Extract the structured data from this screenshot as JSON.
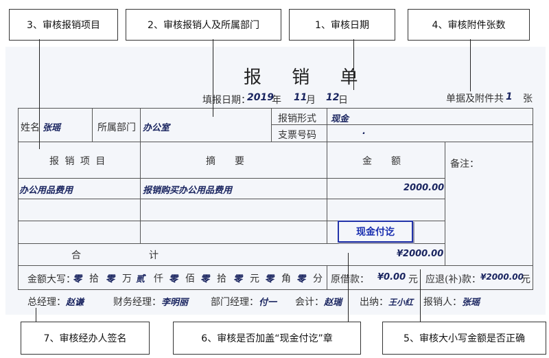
{
  "callouts": {
    "c1": "1、审核日期",
    "c2": "2、审核报销人及所属部门",
    "c3": "3、审核报销项目",
    "c4": "4、审核附件张数",
    "c5": "5、审核大小写金额是否正确",
    "c6": "6、审核是否加盖“现金付讫”章",
    "c7": "7、审核经办人签名"
  },
  "form": {
    "title": "报 销 单",
    "date_label": "填报日期：",
    "year": "2019",
    "year_unit": "年",
    "month": "11",
    "month_unit": "月",
    "day": "12",
    "day_unit": "日",
    "attach_label": "单据及附件共",
    "attach_count": "1",
    "attach_unit": "张",
    "name_label": "姓名",
    "name_value": "张瑶",
    "dept_label": "所属部门",
    "dept_value": "办公室",
    "reimb_type_label": "报销形式",
    "reimb_type_value": "现金",
    "check_no_label": "支票号码",
    "check_no_value": ".",
    "col_item": "报 销 项 目",
    "col_summary": "摘　　要",
    "col_amount": "金　　额",
    "remarks_label": "备注：",
    "rows": [
      {
        "item": "办公用品费用",
        "summary": "报销购买办公用品费用",
        "amount": "2000.00"
      },
      {
        "item": "",
        "summary": "",
        "amount": ""
      },
      {
        "item": "",
        "summary": "",
        "amount": ""
      }
    ],
    "stamp": "现金付讫",
    "total_label_1": "合",
    "total_label_2": "计",
    "total_value": "¥2000.00",
    "capital_label": "金额大写：",
    "capital_parts": [
      {
        "v": "零",
        "u": "拾"
      },
      {
        "v": "零",
        "u": "万"
      },
      {
        "v": "贰",
        "u": "仟"
      },
      {
        "v": "零",
        "u": "佰"
      },
      {
        "v": "零",
        "u": "拾"
      },
      {
        "v": "零",
        "u": "元"
      },
      {
        "v": "零",
        "u": "角"
      },
      {
        "v": "零",
        "u": "分"
      }
    ],
    "original_loan_label": "原借款：",
    "original_loan_value": "¥0.00",
    "original_loan_unit": "元",
    "refund_label": "应退(补)款：",
    "refund_value": "¥2000.00",
    "refund_unit": "元"
  },
  "signatures": [
    {
      "label": "总经理：",
      "name": "赵谦"
    },
    {
      "label": "财务经理：",
      "name": "李明丽"
    },
    {
      "label": "部门经理：",
      "name": "付一"
    },
    {
      "label": "会计：",
      "name": "赵瑞"
    },
    {
      "label": "出纳：",
      "name": "王小红"
    },
    {
      "label": "报销人：",
      "name": "张瑶"
    }
  ]
}
